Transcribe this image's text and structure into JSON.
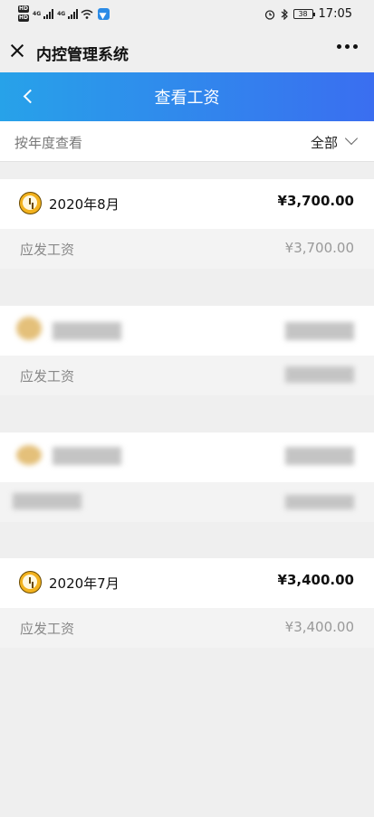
{
  "status_bar": {
    "hd_top": "HD",
    "hd_bottom": "HD",
    "signal1": "4G",
    "signal2": "4G",
    "battery": "38",
    "time": "17:05"
  },
  "wechat_bar": {
    "title": "内控管理系统"
  },
  "header": {
    "title": "查看工资"
  },
  "filter": {
    "label": "按年度查看",
    "value": "全部"
  },
  "records": [
    {
      "month": "2020年8月",
      "amount": "¥3,700.00",
      "sub_label": "应发工资",
      "sub_amount": "¥3,700.00"
    },
    {
      "sub_label": "应发工资"
    },
    {},
    {
      "month": "2020年7月",
      "amount": "¥3,400.00",
      "sub_label": "应发工资",
      "sub_amount": "¥3,400.00"
    }
  ]
}
